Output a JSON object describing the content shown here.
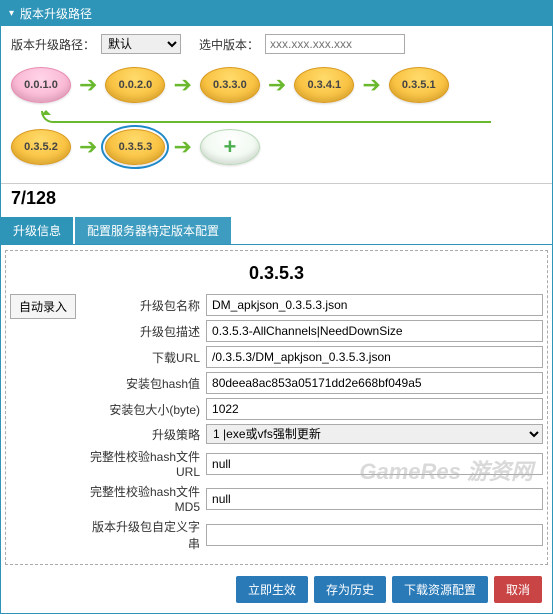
{
  "panel": {
    "title": "版本升级路径"
  },
  "top": {
    "path_label": "版本升级路径：",
    "path_value": "默认",
    "select_label": "选中版本：",
    "select_placeholder": "xxx.xxx.xxx.xxx"
  },
  "flow": {
    "nodes_row1": [
      "0.0.1.0",
      "0.0.2.0",
      "0.3.3.0",
      "0.3.4.1",
      "0.3.5.1"
    ],
    "nodes_row2": [
      "0.3.5.2",
      "0.3.5.3"
    ],
    "current": "0.3.5.3"
  },
  "counter": "7/128",
  "tabs": [
    "升级信息",
    "配置服务器特定版本配置"
  ],
  "form": {
    "title": "0.3.5.3",
    "auto_btn": "自动录入",
    "rows": [
      {
        "label": "升级包名称",
        "value": "DM_apkjson_0.3.5.3.json"
      },
      {
        "label": "升级包描述",
        "value": "0.3.5.3-AllChannels|NeedDownSize"
      },
      {
        "label": "下载URL",
        "value": "/0.3.5.3/DM_apkjson_0.3.5.3.json"
      },
      {
        "label": "安装包hash值",
        "value": "80deea8ac853a05171dd2e668bf049a5"
      },
      {
        "label": "安装包大小(byte)",
        "value": "1022"
      },
      {
        "label": "升级策略",
        "value": "1 |exe或vfs强制更新",
        "type": "select"
      },
      {
        "label": "完整性校验hash文件URL",
        "value": "null"
      },
      {
        "label": "完整性校验hash文件MD5",
        "value": "null"
      },
      {
        "label": "版本升级包自定义字串",
        "value": ""
      }
    ]
  },
  "buttons": [
    "立即生效",
    "存为历史",
    "下载资源配置",
    "取消"
  ],
  "watermark": "GameRes 游资网"
}
